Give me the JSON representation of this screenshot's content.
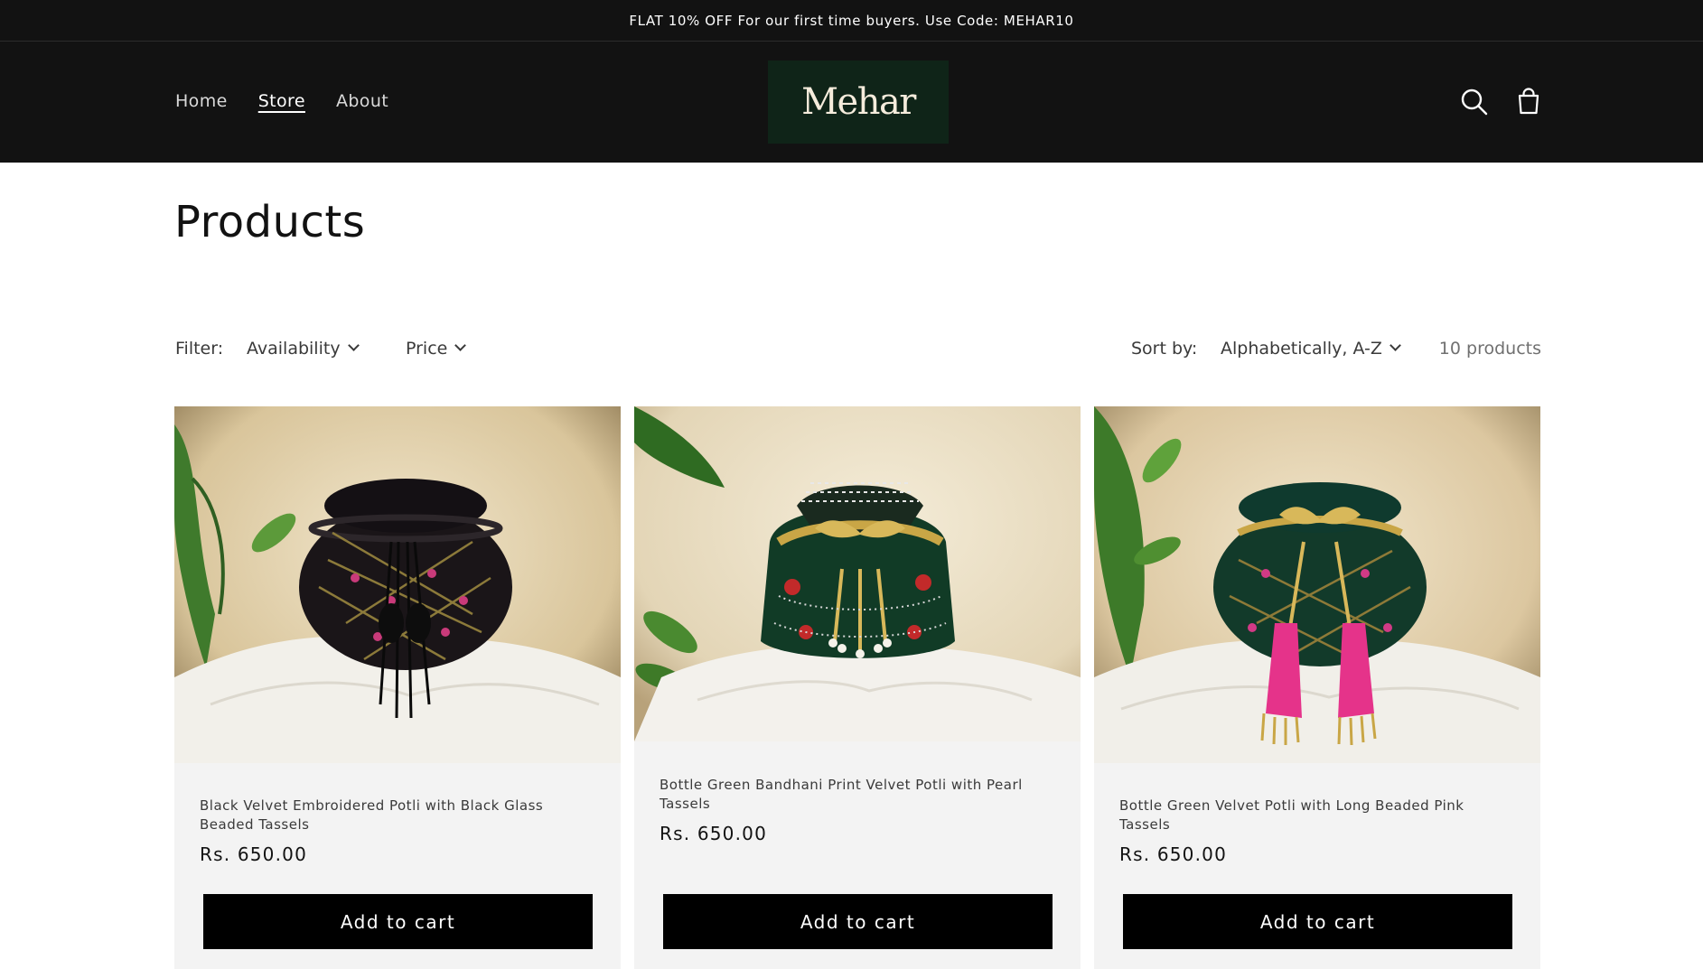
{
  "announcement": {
    "text": "FLAT 10% OFF For our first time buyers. Use Code: MEHAR10"
  },
  "header": {
    "nav": [
      {
        "label": "Home",
        "active": false
      },
      {
        "label": "Store",
        "active": true
      },
      {
        "label": "About",
        "active": false
      }
    ],
    "logo_text": "Mehar",
    "icons": [
      "search-icon",
      "cart-icon"
    ]
  },
  "page": {
    "title": "Products"
  },
  "filters": {
    "label": "Filter:",
    "availability": "Availability",
    "price": "Price",
    "sort_label": "Sort by:",
    "sort_value": "Alphabetically, A-Z",
    "count": "10 products"
  },
  "products": [
    {
      "name": "Black Velvet Embroidered Potli with Black Glass Beaded Tassels",
      "price": "Rs. 650.00",
      "button": "Add to cart"
    },
    {
      "name": "Bottle Green Bandhani Print Velvet Potli with Pearl Tassels",
      "price": "Rs. 650.00",
      "button": "Add to cart"
    },
    {
      "name": "Bottle Green Velvet Potli with Long Beaded Pink Tassels",
      "price": "Rs. 650.00",
      "button": "Add to cart"
    }
  ],
  "colors": {
    "header_bg": "#121212",
    "logo_bg": "#0f2418",
    "button_bg": "#000000",
    "card_bg": "#f3f3f3"
  }
}
